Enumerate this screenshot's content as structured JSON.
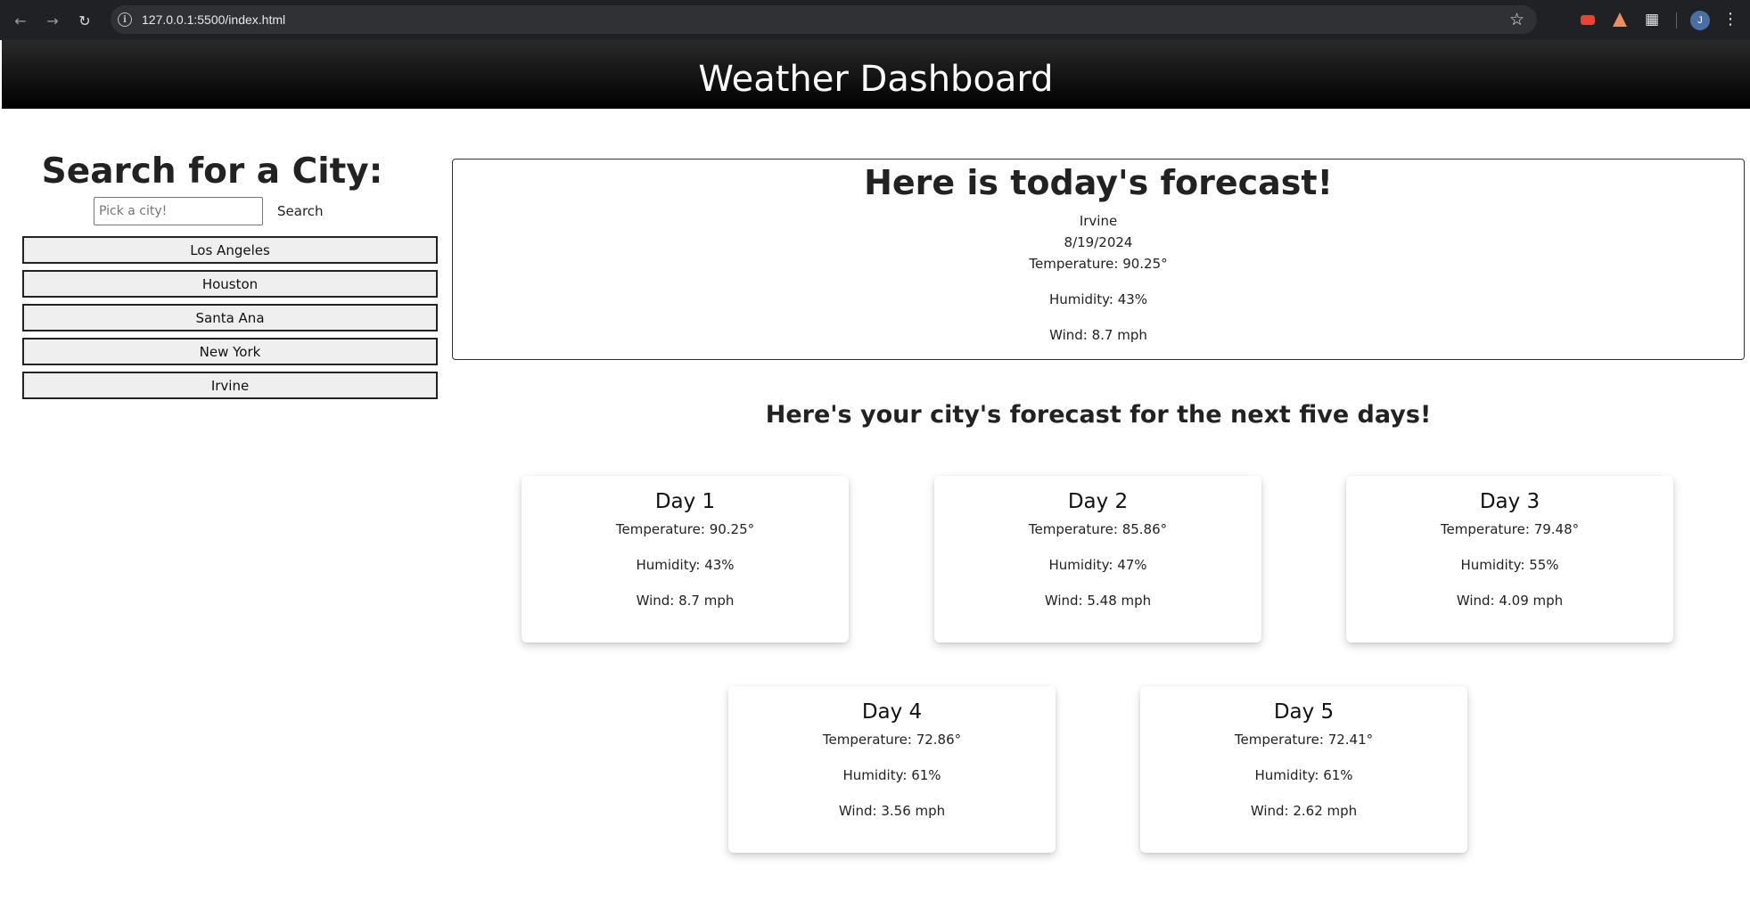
{
  "browser": {
    "url": "127.0.0.1:5500/index.html",
    "profile_initial": "J"
  },
  "header": {
    "title": "Weather Dashboard"
  },
  "sidebar": {
    "title": "Search for a City:",
    "search_placeholder": "Pick a city!",
    "search_label": "Search",
    "cities": [
      "Los Angeles",
      "Houston",
      "Santa Ana",
      "New York",
      "Irvine"
    ]
  },
  "today": {
    "title": "Here is today's forecast!",
    "city": "Irvine",
    "date": "8/19/2024",
    "temperature": "Temperature: 90.25°",
    "humidity": "Humidity: 43%",
    "wind": "Wind: 8.7 mph"
  },
  "forecast": {
    "title": "Here's your city's forecast for the next five days!",
    "days": [
      {
        "label": "Day 1",
        "temperature": "Temperature: 90.25°",
        "humidity": "Humidity: 43%",
        "wind": "Wind: 8.7 mph"
      },
      {
        "label": "Day 2",
        "temperature": "Temperature: 85.86°",
        "humidity": "Humidity: 47%",
        "wind": "Wind: 5.48 mph"
      },
      {
        "label": "Day 3",
        "temperature": "Temperature: 79.48°",
        "humidity": "Humidity: 55%",
        "wind": "Wind: 4.09 mph"
      },
      {
        "label": "Day 4",
        "temperature": "Temperature: 72.86°",
        "humidity": "Humidity: 61%",
        "wind": "Wind: 3.56 mph"
      },
      {
        "label": "Day 5",
        "temperature": "Temperature: 72.41°",
        "humidity": "Humidity: 61%",
        "wind": "Wind: 2.62 mph"
      }
    ]
  }
}
